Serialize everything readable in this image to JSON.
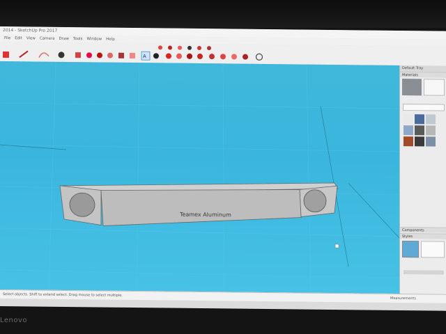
{
  "window": {
    "title": "2014 - SketchUp Pro 2017"
  },
  "menu": [
    "File",
    "Edit",
    "View",
    "Camera",
    "Draw",
    "Tools",
    "Window",
    "Help"
  ],
  "model": {
    "engraved_text": "Teamex Aluminum"
  },
  "tray": {
    "title": "Default Tray",
    "materials_header": "Materials",
    "components_header": "Components",
    "styles_header": "Styles"
  },
  "statusbar": {
    "message": "Select objects. Shift to extend select. Drag mouse to select multiple.",
    "measurements": "Measurements"
  },
  "bezel_brand": "Lenovo",
  "colors": {
    "viewport": "#3ab5dd",
    "accent": "#3a8bd8"
  }
}
